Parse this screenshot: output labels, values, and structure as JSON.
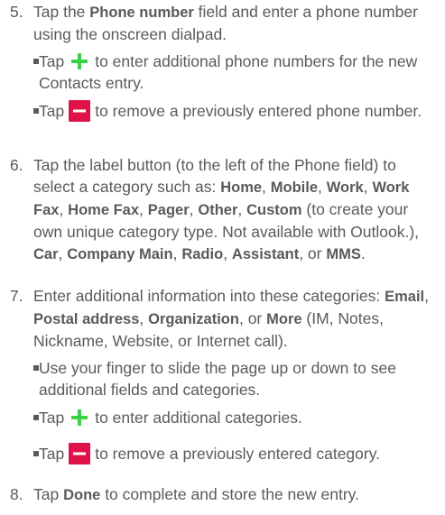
{
  "step5": {
    "num": "5.",
    "pre": "Tap the ",
    "field": "Phone number",
    "post": " field and enter a phone number using the onscreen dialpad.",
    "add_pre": "Tap",
    "add_post": "to enter additional phone numbers for the new Contacts entry.",
    "remove_pre": "Tap",
    "remove_post": "to remove a previously entered phone number."
  },
  "step6": {
    "num": "6.",
    "pre": "Tap the label button (to the left of the Phone field) to select a category such as: ",
    "c1": "Home",
    "c2": "Mobile",
    "c3": "Work",
    "c4": "Work Fax",
    "c5": "Home Fax",
    "c6": "Pager",
    "c7": "Other",
    "c8": "Custom",
    "custom_note": " (to create your own unique category type. Not available with Outlook.), ",
    "c9": "Car",
    "c10": "Company Main",
    "c11": "Radio",
    "c12": "Assistant",
    "or": ", or ",
    "c13": "MMS",
    "end": "."
  },
  "step7": {
    "num": "7.",
    "pre": "Enter additional information into these categories: ",
    "c1": "Email",
    "c2": "Postal address",
    "c3": "Organization",
    "or": ", or ",
    "c4": "More",
    "post": " (IM, Notes, Nickname, Website, or Internet call).",
    "slide": "Use your finger to slide the page up or down to see additional fields and categories.",
    "add_pre": "Tap",
    "add_post": "to enter additional categories.",
    "remove_pre": "Tap",
    "remove_post": "to remove a previously entered category."
  },
  "step8": {
    "num": "8.",
    "pre": "Tap ",
    "btn": "Done",
    "post": " to complete and store the new entry."
  },
  "icons": {
    "add": "plus-icon",
    "remove": "minus-icon",
    "add_color": "#39d14a",
    "remove_color": "#e0124a"
  }
}
